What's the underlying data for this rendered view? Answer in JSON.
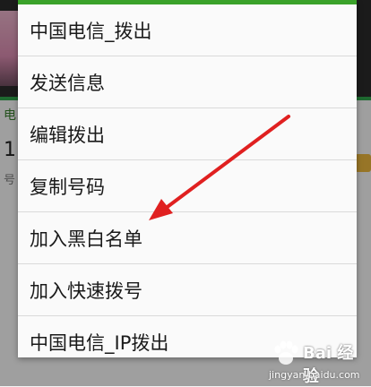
{
  "background_app": {
    "row_label": "电",
    "big_number": "1",
    "small_label": "号"
  },
  "menu": {
    "items": [
      {
        "label": "中国电信_拨出"
      },
      {
        "label": "发送信息"
      },
      {
        "label": "编辑拨出"
      },
      {
        "label": "复制号码"
      },
      {
        "label": "加入黑白名单"
      },
      {
        "label": "加入快速拨号"
      },
      {
        "label": "中国电信_IP拨出"
      }
    ]
  },
  "annotation": {
    "color": "#e02020"
  },
  "watermark": {
    "title": "Bai 经验",
    "url": "jingyan.baidu.com"
  },
  "colors": {
    "accent_green": "#3aa22a",
    "arrow_red": "#e02020"
  }
}
